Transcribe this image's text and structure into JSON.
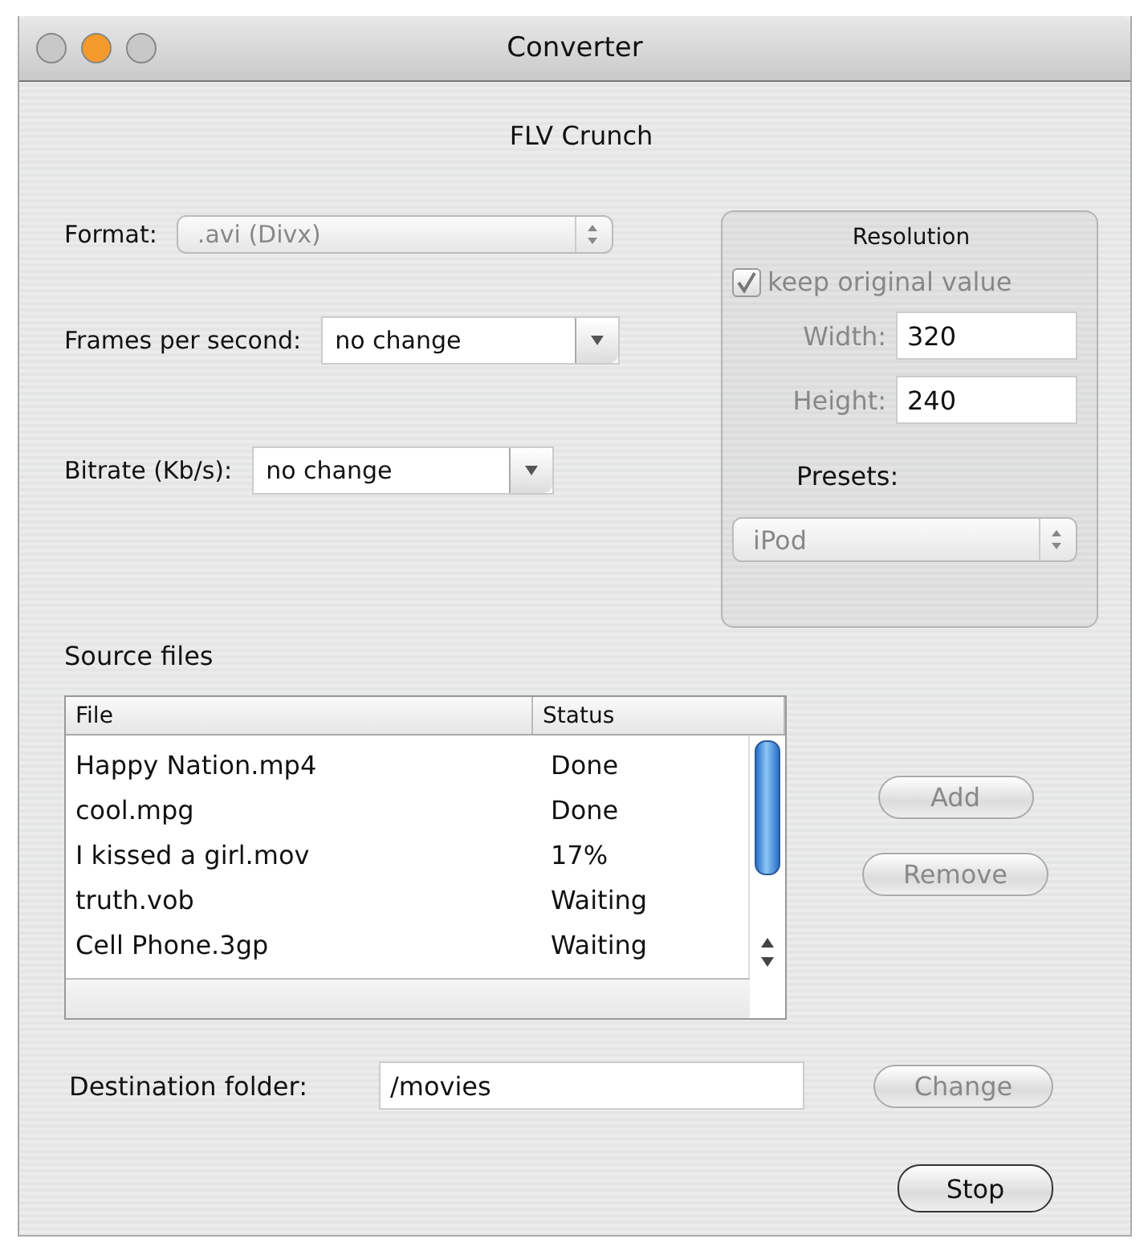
{
  "window": {
    "title": "Converter"
  },
  "heading": "FLV Crunch",
  "settings": [
    {
      "label": "Format:",
      "value": ".avi (Divx)",
      "kind": "popup",
      "disabled": true
    },
    {
      "label": "Frames per second:",
      "value": "no change",
      "kind": "combo",
      "disabled": false
    },
    {
      "label": "Bitrate (Kb/s):",
      "value": "no change",
      "kind": "combo",
      "disabled": false
    }
  ],
  "resolution": {
    "title": "Resolution",
    "disabled": true,
    "keep_original": {
      "label": "keep original value",
      "checked": true
    },
    "fields": [
      {
        "label": "Width:",
        "value": "320"
      },
      {
        "label": "Height:",
        "value": "240"
      }
    ],
    "presets": {
      "label": "Presets:",
      "value": "iPod"
    }
  },
  "source_files": {
    "label": "Source files",
    "columns": [
      "File",
      "Status"
    ],
    "rows": [
      {
        "file": "Happy Nation.mp4",
        "status": "Done"
      },
      {
        "file": "cool.mpg",
        "status": "Done"
      },
      {
        "file": "I kissed a girl.mov",
        "status": "17%"
      },
      {
        "file": "truth.vob",
        "status": "Waiting"
      },
      {
        "file": "Cell Phone.3gp",
        "status": "Waiting"
      }
    ]
  },
  "file_buttons": [
    {
      "label": "Add",
      "disabled": true
    },
    {
      "label": "Remove",
      "disabled": true
    }
  ],
  "destination": {
    "label": "Destination folder:",
    "value": "/movies",
    "button": {
      "label": "Change",
      "disabled": true
    }
  },
  "stop_button": {
    "label": "Stop",
    "disabled": false
  }
}
